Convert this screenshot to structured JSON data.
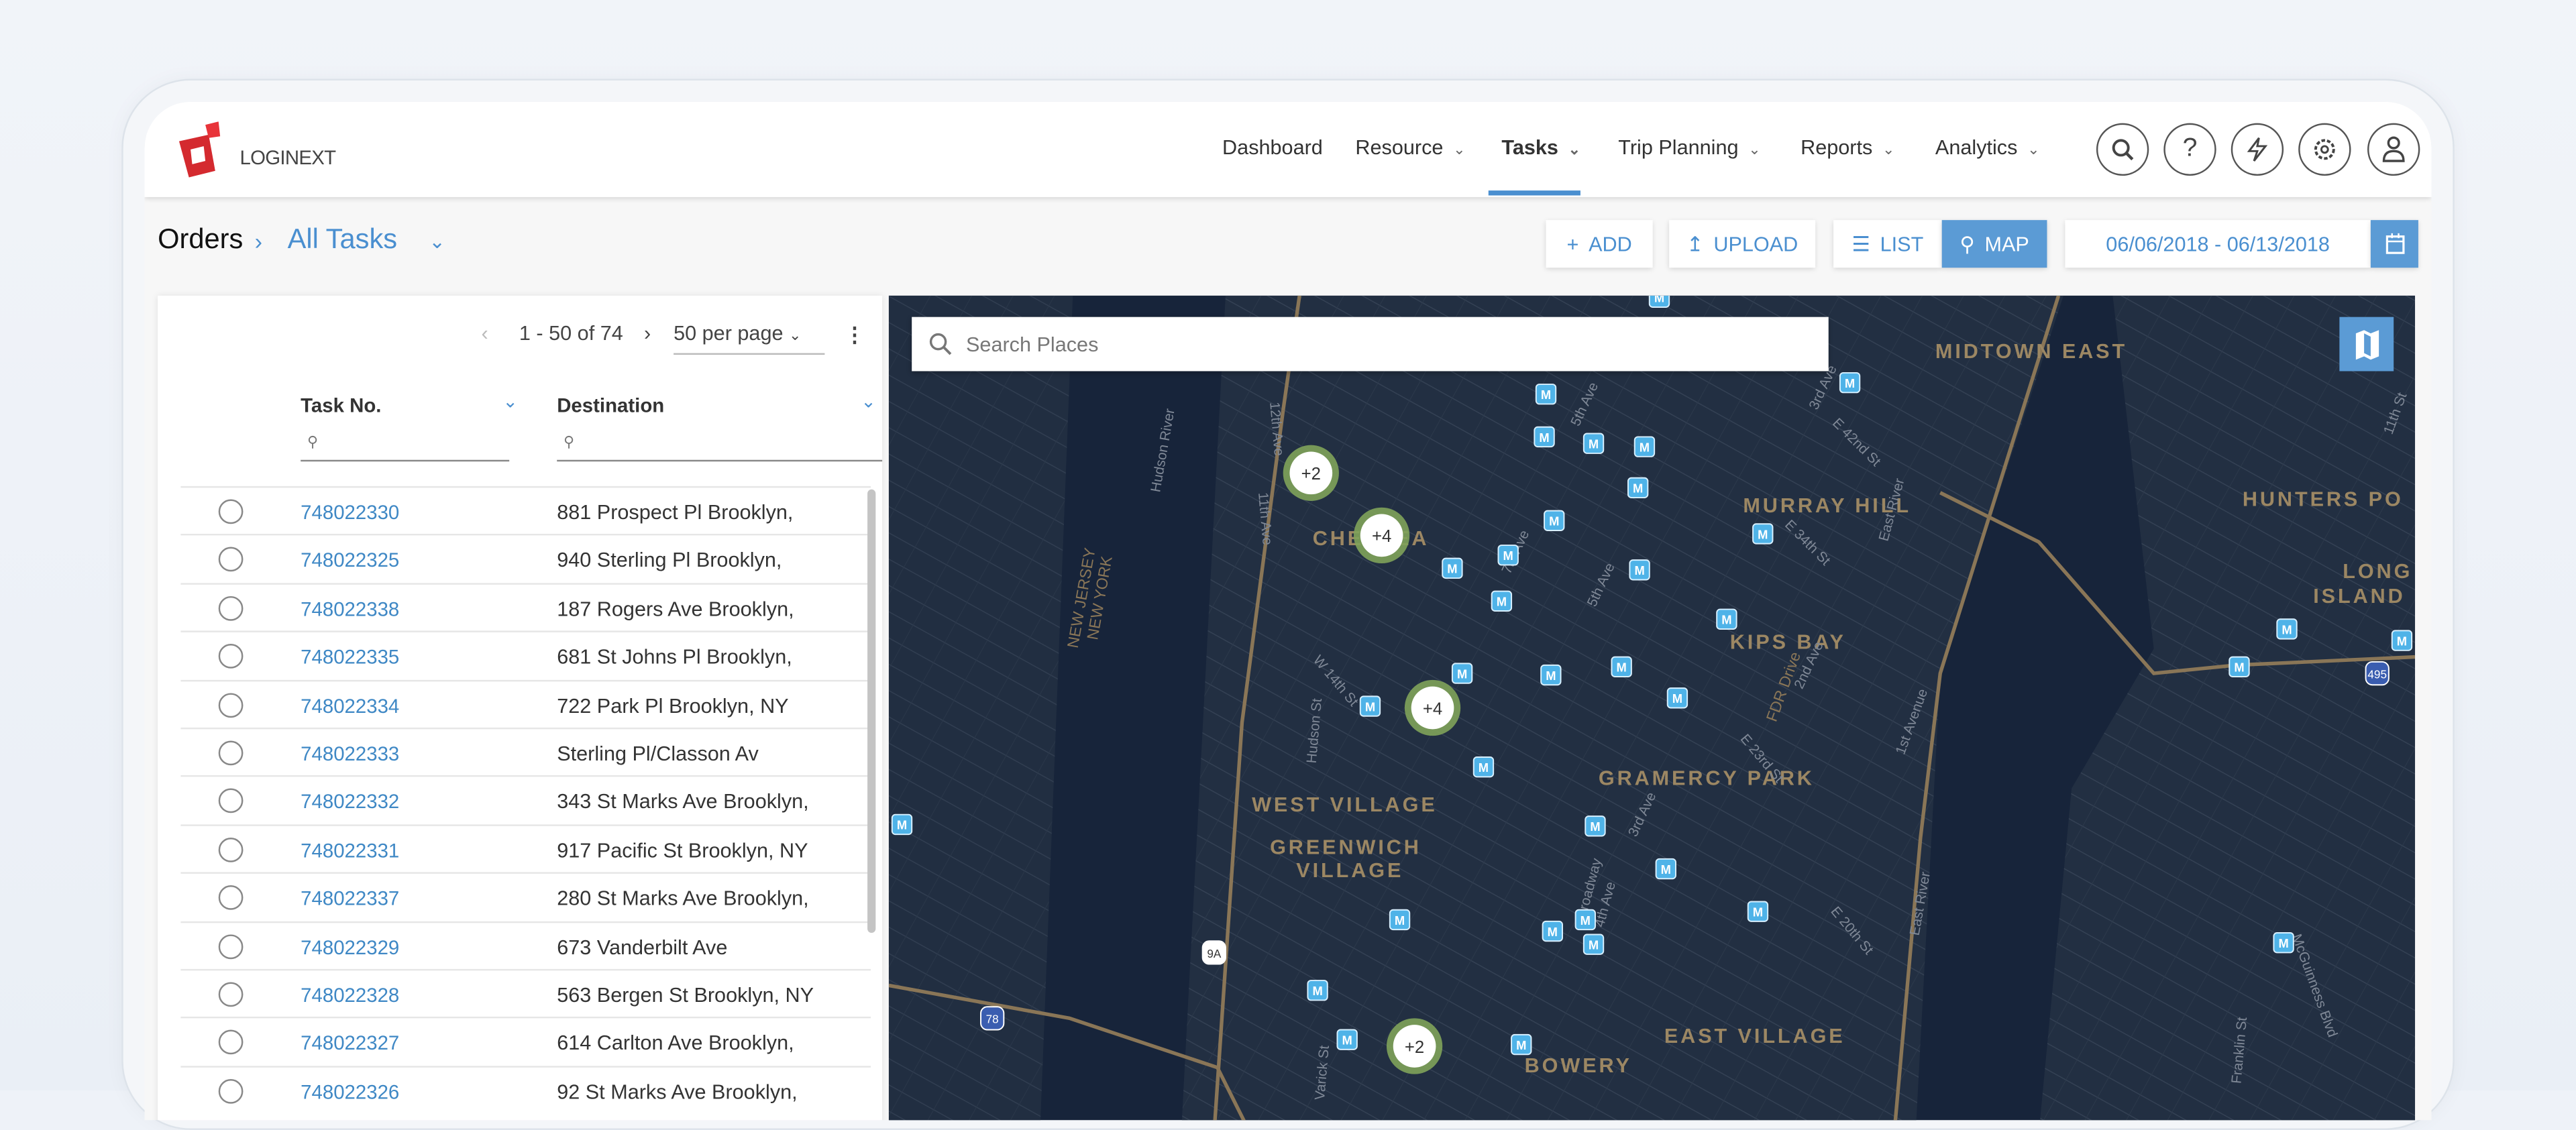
{
  "app": {
    "logo_text": "LOGINEXT"
  },
  "nav": {
    "items": [
      {
        "label": "Dashboard"
      },
      {
        "label": "Resource"
      },
      {
        "label": "Tasks"
      },
      {
        "label": "Trip Planning"
      },
      {
        "label": "Reports"
      },
      {
        "label": "Analytics"
      }
    ],
    "active": "Tasks"
  },
  "header_icons": [
    "search-icon",
    "help-icon",
    "lightning-icon",
    "gear-icon",
    "user-icon"
  ],
  "breadcrumb": {
    "root": "Orders",
    "current": "All Tasks"
  },
  "toolbar": {
    "add": "ADD",
    "upload": "UPLOAD",
    "list": "LIST",
    "map": "MAP",
    "date_range": "06/06/2018 - 06/13/2018"
  },
  "colors": {
    "accent": "#5b9bd5",
    "link": "#3f88c5",
    "map_bg": "#17243a",
    "cluster": "#7fa35a"
  },
  "table": {
    "pagination": {
      "range": "1 - 50 of 74",
      "per_page": "50 per page"
    },
    "columns": [
      "Task No.",
      "Destination"
    ],
    "rows": [
      {
        "task": "748022330",
        "dest": "881 Prospect Pl Brooklyn,"
      },
      {
        "task": "748022325",
        "dest": "940 Sterling Pl Brooklyn,"
      },
      {
        "task": "748022338",
        "dest": "187 Rogers Ave Brooklyn,"
      },
      {
        "task": "748022335",
        "dest": "681 St Johns Pl Brooklyn,"
      },
      {
        "task": "748022334",
        "dest": "722 Park Pl Brooklyn, NY"
      },
      {
        "task": "748022333",
        "dest": "Sterling Pl/Classon Av"
      },
      {
        "task": "748022332",
        "dest": "343 St Marks Ave Brooklyn,"
      },
      {
        "task": "748022331",
        "dest": "917 Pacific St Brooklyn, NY"
      },
      {
        "task": "748022337",
        "dest": "280 St Marks Ave Brooklyn,"
      },
      {
        "task": "748022329",
        "dest": "673 Vanderbilt Ave"
      },
      {
        "task": "748022328",
        "dest": "563 Bergen St Brooklyn, NY"
      },
      {
        "task": "748022327",
        "dest": "614 Carlton Ave Brooklyn,"
      },
      {
        "task": "748022326",
        "dest": "92 St Marks Ave Brooklyn,"
      }
    ]
  },
  "map": {
    "search_placeholder": "Search Places",
    "neighborhoods": [
      "MIDTOWN EAST",
      "MURRAY HILL",
      "HUNTERS PO",
      "LONG",
      "ISLAND",
      "KIPS BAY",
      "GRAMERCY PARK",
      "WEST VILLAGE",
      "GREENWICH",
      "VILLAGE",
      "EAST VILLAGE",
      "BOWERY",
      "CHELSEA"
    ],
    "streets": [
      "Hudson River",
      "NEW JERSEY",
      "NEW YORK",
      "East River",
      "East River",
      "FDR Drive",
      "12th Ave",
      "11th Ave",
      "W 14th St",
      "Hudson St",
      "E 34th St",
      "E 23rd St",
      "E 20th St",
      "E 42nd St",
      "5th Ave",
      "5th Ave",
      "7th Ave",
      "7th Ave",
      "2nd Ave",
      "3rd Ave",
      "3rd Ave",
      "Broadway",
      "4th Ave",
      "1st Avenue",
      "Varick St",
      "Franklin St",
      "McGuinness Blvd",
      "11th St"
    ],
    "shields": [
      "9A",
      "78",
      "495"
    ],
    "clusters": [
      "+2",
      "+4",
      "+4",
      "+2"
    ],
    "marker_label": "M"
  }
}
